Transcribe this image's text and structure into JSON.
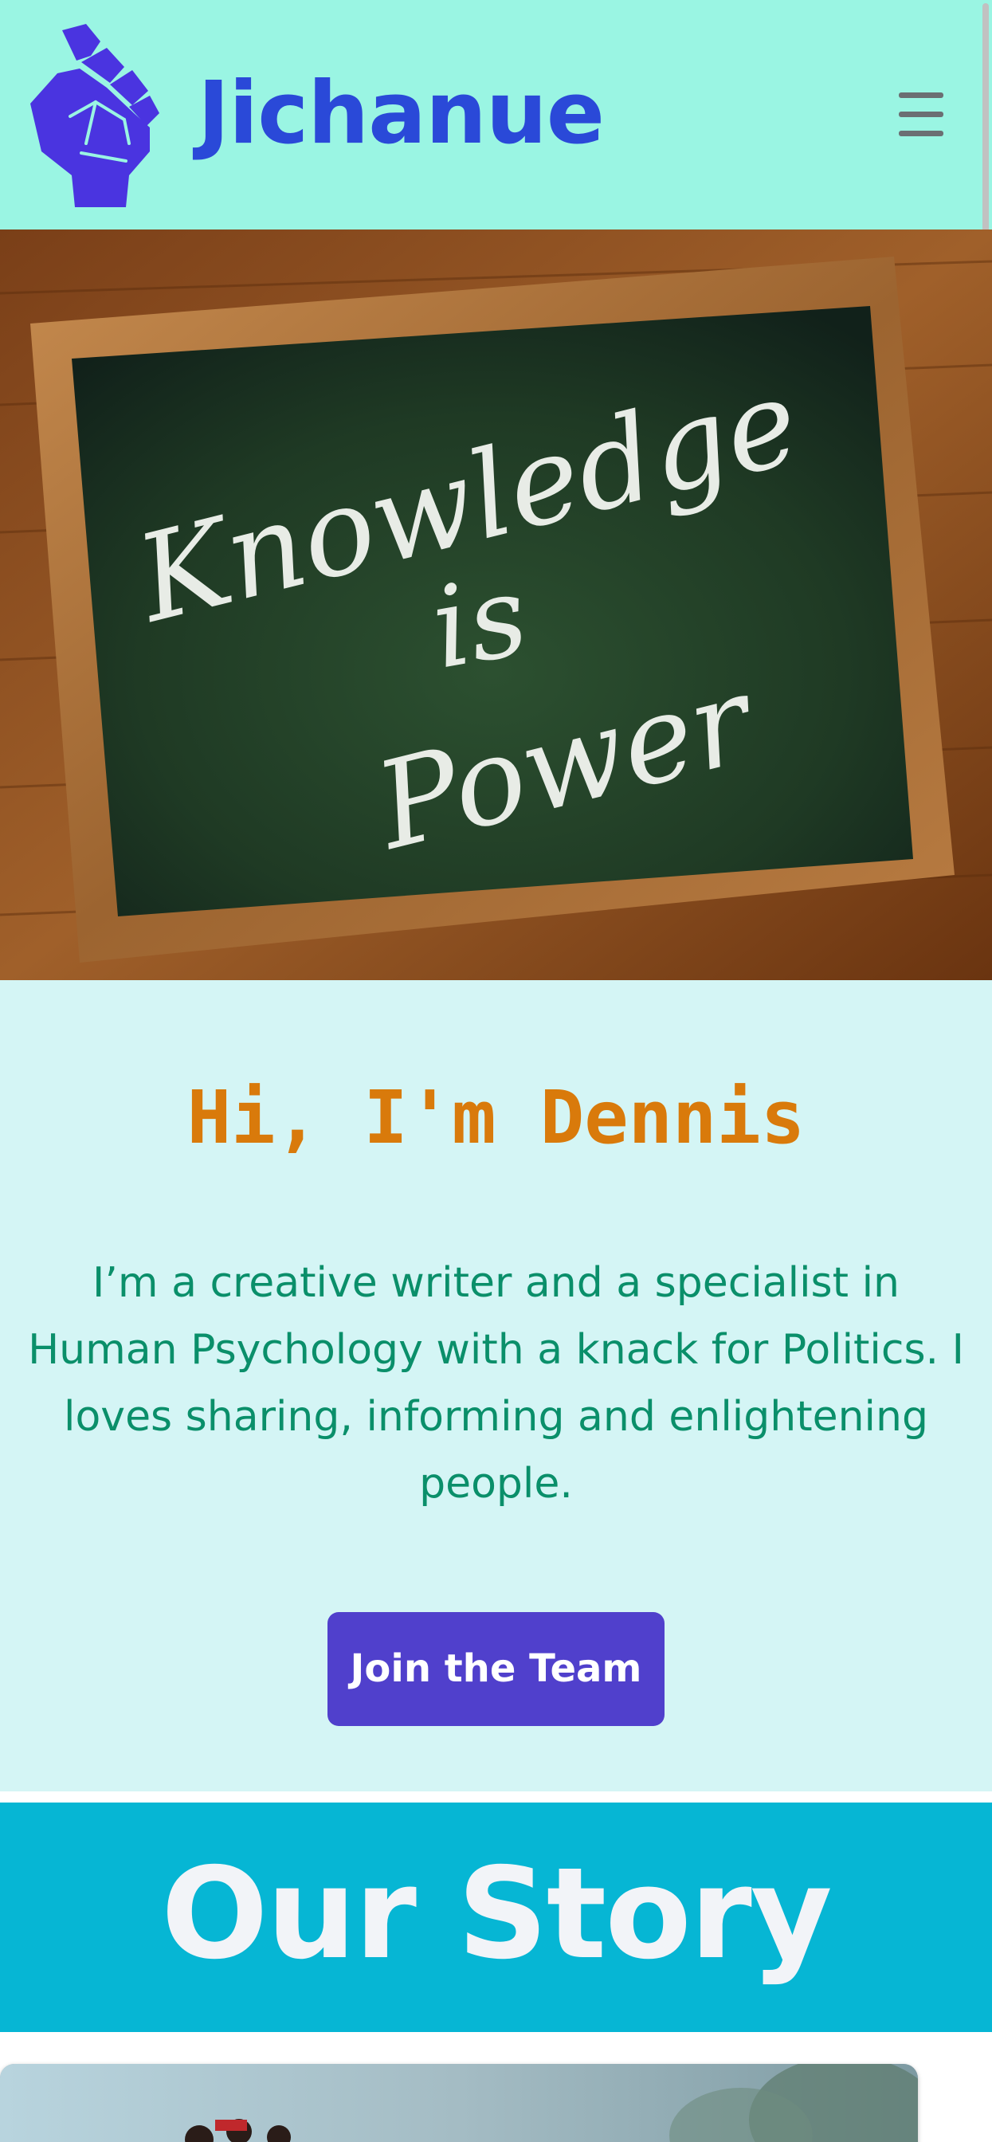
{
  "header": {
    "brand": "Jichanue",
    "logo_icon": "raised-fist-icon",
    "menu_icon": "hamburger-menu-icon",
    "colors": {
      "background": "#9af5e3",
      "brand": "#2a49d8",
      "logo": "#4a34e0"
    }
  },
  "hero": {
    "image": "chalkboard-photo",
    "chalk_text": [
      "Knowledge",
      "is",
      "Power"
    ]
  },
  "intro": {
    "title": "Hi, I'm Dennis",
    "text": "I’m a creative writer and a specialist in Human Psychology with a knack for Politics. I loves sharing, informing and enlightening people.",
    "button_label": "Join the Team",
    "colors": {
      "background": "#d4f5f5",
      "title": "#d97a0b",
      "text": "#0a8f6a",
      "button": "#5040cc"
    }
  },
  "story": {
    "title": "Our Story",
    "image": "protest-photo",
    "colors": {
      "background": "#06b6d4",
      "title": "#f2f4f8"
    }
  }
}
